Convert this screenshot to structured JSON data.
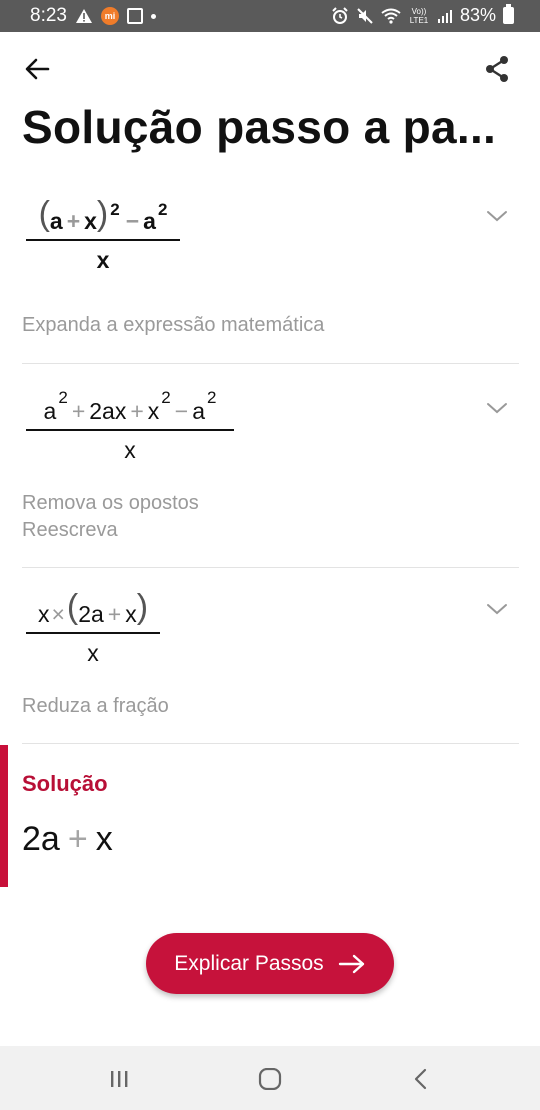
{
  "status_bar": {
    "time": "8:23",
    "mi_badge": "mi",
    "battery": "83%",
    "volte": "Vo)) LTE1",
    "icons": [
      "warning-icon",
      "mi-icon",
      "notification-box-icon",
      "alarm-icon",
      "mute-icon",
      "wifi-icon",
      "signal-icon",
      "battery-icon"
    ]
  },
  "header": {
    "title": "Solução passo a pa...",
    "back_icon": "arrow-left-icon",
    "share_icon": "share-icon"
  },
  "steps": [
    {
      "num_parts": [
        "(",
        "a",
        "+",
        "x",
        ")",
        "2",
        "−",
        "a",
        "2"
      ],
      "den": "x",
      "desc": [
        "Expanda a expressão matemática"
      ]
    },
    {
      "num_parts": [
        "a",
        "2",
        "+",
        "2ax",
        "+",
        "x",
        "2",
        "−",
        "a",
        "2"
      ],
      "den": "x",
      "desc": [
        "Remova os opostos",
        "Reescreva"
      ]
    },
    {
      "num_parts": [
        "x",
        "×",
        "(",
        "2a",
        "+",
        "x",
        ")"
      ],
      "den": "x",
      "desc": [
        "Reduza a fração"
      ]
    }
  ],
  "solution": {
    "label": "Solução",
    "parts": [
      "2a",
      "+",
      "x"
    ]
  },
  "cta": {
    "label": "Explicar Passos"
  },
  "colors": {
    "accent": "#c6123b",
    "status_bar": "#5a5a5a",
    "muted_text": "#9a9a9a"
  }
}
